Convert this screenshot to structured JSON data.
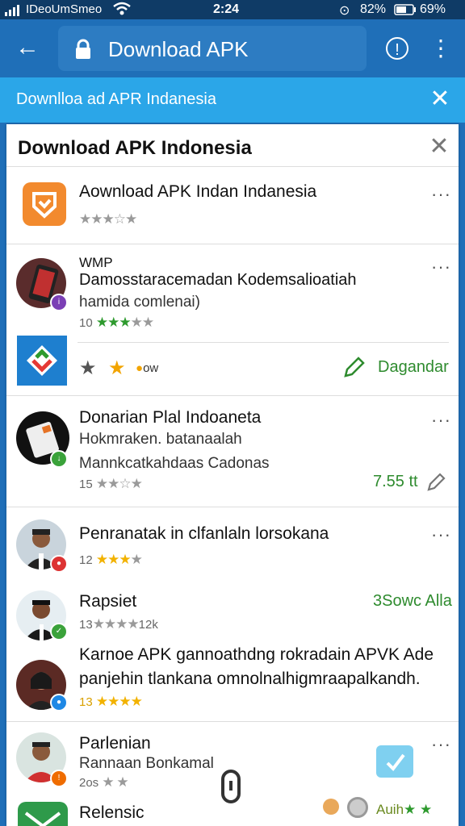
{
  "status": {
    "carrier": "IDeoUmSmeo",
    "time": "2:24",
    "battery1": "82%",
    "battery2": "69%"
  },
  "appbar": {
    "url_text": "Download APK"
  },
  "banner": {
    "text": "Downlloa ad APR Indanesia"
  },
  "sheet": {
    "title": "Download APK Indonesia"
  },
  "items": [
    {
      "title": "Aownload APK Indan Indanesia"
    },
    {
      "title": "WMP",
      "sub1": "Damosstaracemadan Kodemsalioatiah",
      "sub2": "hamida comlenai)",
      "rating": "10"
    },
    {
      "chip": "ow",
      "action": "Dagandar"
    },
    {
      "title": "Donarian Plal Indoaneta",
      "sub1": "Hokmraken. batanaalah",
      "sub2": "Mannkcatkahdaas Cadonas",
      "rating": "15",
      "size": "7.55 tt"
    },
    {
      "title": "Penranatak in clfanlaln lorsokana",
      "rating": "12"
    },
    {
      "title": "Rapsiet",
      "rating": "13",
      "count": "12k",
      "right": "3Sowc Alla"
    },
    {
      "title": "Karnoe APK gannoathdng rokradain APVK Ade",
      "sub1": "panjehin tlankana omnolnalhigmraapalkandh.",
      "rating": "13"
    },
    {
      "title": "Parlenian",
      "sub1": "Rannaan Bonkamal",
      "rating": "2os"
    },
    {
      "title": "Relensic",
      "right": "Auih"
    }
  ],
  "colors": {
    "appbar": "#1f6fb8",
    "banner": "#2ba6e8",
    "accent_green": "#2e8b2e",
    "star_yellow": "#f2b200"
  }
}
